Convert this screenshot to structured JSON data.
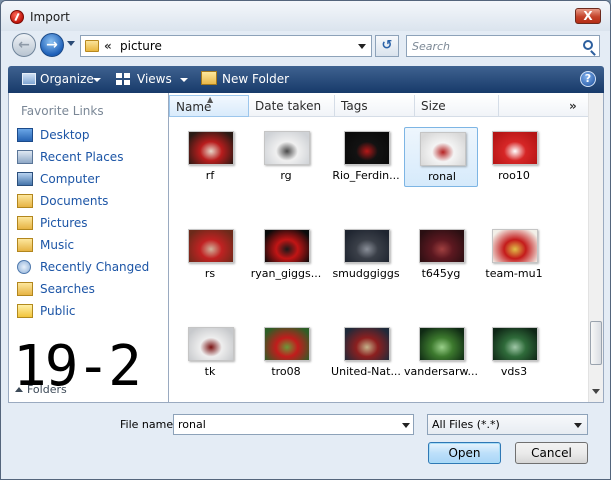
{
  "window": {
    "title": "Import",
    "close_glyph": "X"
  },
  "address": {
    "chevrons": "«",
    "path": "picture"
  },
  "search": {
    "placeholder": "Search"
  },
  "toolbar": {
    "organize": "Organize",
    "views": "Views",
    "new_folder": "New Folder",
    "help_glyph": "?"
  },
  "nav": {
    "heading": "Favorite Links",
    "items": [
      {
        "label": "Desktop",
        "icon": "desktop-icon"
      },
      {
        "label": "Recent Places",
        "icon": "recent-places-icon"
      },
      {
        "label": "Computer",
        "icon": "computer-icon"
      },
      {
        "label": "Documents",
        "icon": "documents-icon"
      },
      {
        "label": "Pictures",
        "icon": "pictures-icon"
      },
      {
        "label": "Music",
        "icon": "music-icon"
      },
      {
        "label": "Recently Changed",
        "icon": "recently-changed-icon"
      },
      {
        "label": "Searches",
        "icon": "searches-icon"
      },
      {
        "label": "Public",
        "icon": "public-icon"
      }
    ],
    "folders_label": "Folders"
  },
  "columns": {
    "name": "Name",
    "date": "Date taken",
    "tags": "Tags",
    "size": "Size",
    "more": "»"
  },
  "files": [
    {
      "name": "rf",
      "colors": [
        "#2a1a14",
        "#b81d1d",
        "#e6d6c8"
      ]
    },
    {
      "name": "rg",
      "colors": [
        "#cfd2d6",
        "#f0f0f0",
        "#4a4a4a"
      ]
    },
    {
      "name": "Rio_Ferdin...",
      "colors": [
        "#0a0a0a",
        "#121212",
        "#b51818"
      ]
    },
    {
      "name": "ronal",
      "colors": [
        "#d8d8d8",
        "#f4f4f4",
        "#b52222"
      ]
    },
    {
      "name": "roo10",
      "colors": [
        "#b51515",
        "#d62626",
        "#ffffff"
      ]
    },
    {
      "name": "rs",
      "colors": [
        "#6c2a1a",
        "#c02222",
        "#d0b39c"
      ]
    },
    {
      "name": "ryan_giggs...",
      "colors": [
        "#0b0b0b",
        "#c11515",
        "#1a1a1a"
      ]
    },
    {
      "name": "smudggiggs",
      "colors": [
        "#1f2530",
        "#3a3f48",
        "#8a8f99"
      ]
    },
    {
      "name": "t645yg",
      "colors": [
        "#2a0f12",
        "#5c1820",
        "#a04040"
      ]
    },
    {
      "name": "team-mu1",
      "colors": [
        "#f2efe8",
        "#c41b1b",
        "#e0c048"
      ]
    },
    {
      "name": "tk",
      "colors": [
        "#c7c9cc",
        "#eeeeee",
        "#7a1212"
      ]
    },
    {
      "name": "tro08",
      "colors": [
        "#2e5e26",
        "#c21c1c",
        "#6a9a3a"
      ]
    },
    {
      "name": "United-Nat...",
      "colors": [
        "#202a3a",
        "#8c1f1f",
        "#c5b28a"
      ]
    },
    {
      "name": "vandersarw...",
      "colors": [
        "#0f2a14",
        "#3d7a2e",
        "#9ad08a"
      ]
    },
    {
      "name": "vds3",
      "colors": [
        "#0f2616",
        "#2f6b3a",
        "#a0c8a8"
      ]
    }
  ],
  "selected_file": "ronal",
  "overlay_label": "19-2",
  "bottom": {
    "file_name_label": "File name:",
    "file_name_value": "ronal",
    "file_type": "All Files (*.*)",
    "open": "Open",
    "cancel": "Cancel"
  }
}
